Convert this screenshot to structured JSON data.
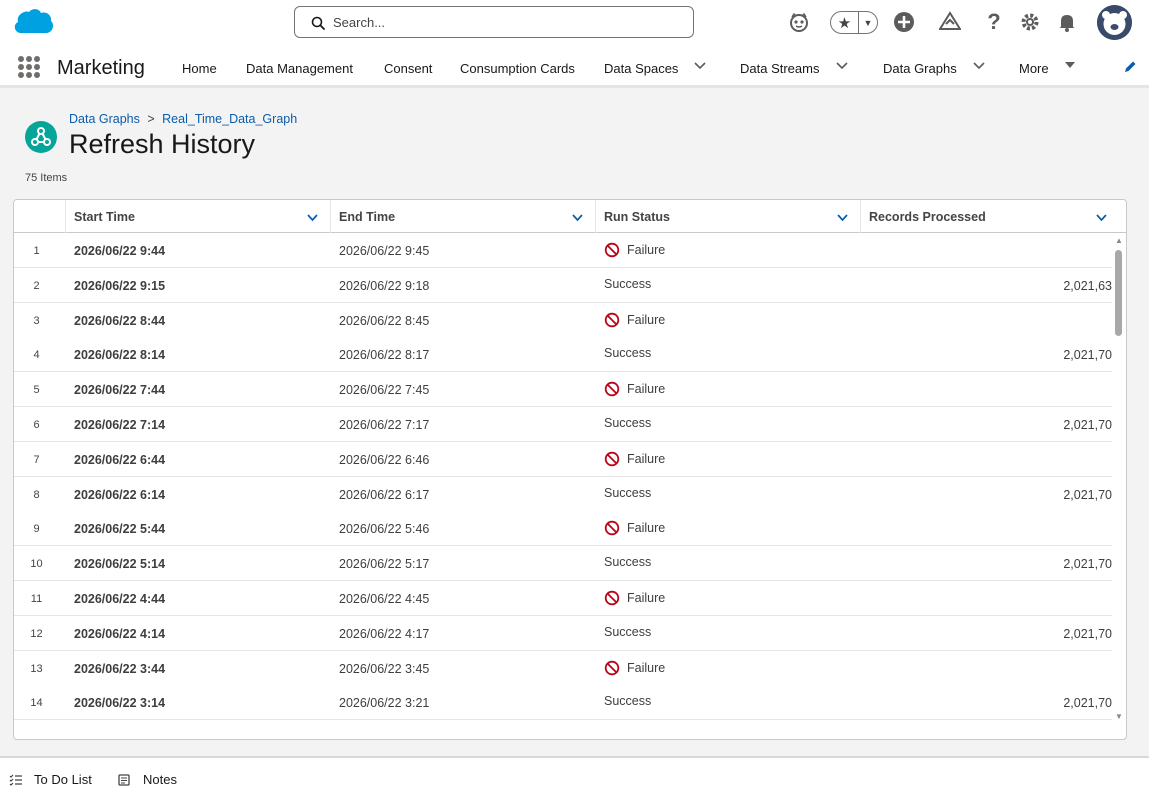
{
  "header": {
    "search_placeholder": "Search..."
  },
  "nav": {
    "app_name": "Marketing",
    "items": [
      {
        "label": "Home"
      },
      {
        "label": "Data Management"
      },
      {
        "label": "Consent"
      },
      {
        "label": "Consumption Cards"
      },
      {
        "label": "Data Spaces"
      },
      {
        "label": "Data Streams"
      },
      {
        "label": "Data Graphs"
      },
      {
        "label": "More"
      }
    ]
  },
  "page": {
    "breadcrumb_parent": "Data Graphs",
    "breadcrumb_separator": ">",
    "breadcrumb_current": "Real_Time_Data_Graph",
    "title": "Refresh History",
    "item_count": "75 Items"
  },
  "table": {
    "columns": [
      "Start Time",
      "End Time",
      "Run Status",
      "Records Processed"
    ],
    "rows": [
      {
        "num": "1",
        "start": "2026/06/22 9:44",
        "end": "2026/06/22 9:45",
        "status": "Failure",
        "records": ""
      },
      {
        "num": "2",
        "start": "2026/06/22 9:15",
        "end": "2026/06/22 9:18",
        "status": "Success",
        "records": "2,021,63"
      },
      {
        "num": "3",
        "start": "2026/06/22 8:44",
        "end": "2026/06/22 8:45",
        "status": "Failure",
        "records": ""
      },
      {
        "num": "4",
        "start": "2026/06/22 8:14",
        "end": "2026/06/22 8:17",
        "status": "Success",
        "records": "2,021,70"
      },
      {
        "num": "5",
        "start": "2026/06/22 7:44",
        "end": "2026/06/22 7:45",
        "status": "Failure",
        "records": ""
      },
      {
        "num": "6",
        "start": "2026/06/22 7:14",
        "end": "2026/06/22 7:17",
        "status": "Success",
        "records": "2,021,70"
      },
      {
        "num": "7",
        "start": "2026/06/22 6:44",
        "end": "2026/06/22 6:46",
        "status": "Failure",
        "records": ""
      },
      {
        "num": "8",
        "start": "2026/06/22 6:14",
        "end": "2026/06/22 6:17",
        "status": "Success",
        "records": "2,021,70"
      },
      {
        "num": "9",
        "start": "2026/06/22 5:44",
        "end": "2026/06/22 5:46",
        "status": "Failure",
        "records": ""
      },
      {
        "num": "10",
        "start": "2026/06/22 5:14",
        "end": "2026/06/22 5:17",
        "status": "Success",
        "records": "2,021,70"
      },
      {
        "num": "11",
        "start": "2026/06/22 4:44",
        "end": "2026/06/22 4:45",
        "status": "Failure",
        "records": ""
      },
      {
        "num": "12",
        "start": "2026/06/22 4:14",
        "end": "2026/06/22 4:17",
        "status": "Success",
        "records": "2,021,70"
      },
      {
        "num": "13",
        "start": "2026/06/22 3:44",
        "end": "2026/06/22 3:45",
        "status": "Failure",
        "records": ""
      },
      {
        "num": "14",
        "start": "2026/06/22 3:14",
        "end": "2026/06/22 3:21",
        "status": "Success",
        "records": "2,021,70"
      }
    ]
  },
  "utility_bar": {
    "todo_label": "To Do List",
    "notes_label": "Notes"
  },
  "colors": {
    "brand_blue": "#0b5cab",
    "cloud_blue": "#00a1e0",
    "failure_red": "#ba0517",
    "page_icon_teal": "#06a59a"
  },
  "icons": [
    "salesforce-cloud-logo",
    "search-icon",
    "einstein-icon",
    "star-icon",
    "add-icon",
    "trailhead-icon",
    "help-icon",
    "setup-gear-icon",
    "bell-icon",
    "avatar",
    "app-launcher-icon",
    "pencil-icon",
    "data-graph-icon",
    "chevron-down-icon",
    "ban-icon",
    "todo-list-icon",
    "notes-icon"
  ]
}
